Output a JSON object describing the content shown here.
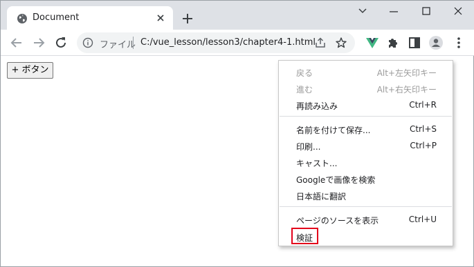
{
  "tab": {
    "title": "Document"
  },
  "omnibox": {
    "scheme_label": "ファイル",
    "url": "C:/vue_lesson/lesson3/chapter4-1.html"
  },
  "page": {
    "button_label": "+ ボタン"
  },
  "context_menu": {
    "items": [
      {
        "label": "戻る",
        "shortcut": "Alt+左矢印キー",
        "enabled": false
      },
      {
        "label": "進む",
        "shortcut": "Alt+右矢印キー",
        "enabled": false
      },
      {
        "label": "再読み込み",
        "shortcut": "Ctrl+R",
        "enabled": true
      },
      {
        "label": "名前を付けて保存...",
        "shortcut": "Ctrl+S",
        "enabled": true
      },
      {
        "label": "印刷...",
        "shortcut": "Ctrl+P",
        "enabled": true
      },
      {
        "label": "キャスト...",
        "shortcut": "",
        "enabled": true
      },
      {
        "label": "Googleで画像を検索",
        "shortcut": "",
        "enabled": true
      },
      {
        "label": "日本語に翻訳",
        "shortcut": "",
        "enabled": true
      },
      {
        "label": "ページのソースを表示",
        "shortcut": "Ctrl+U",
        "enabled": true
      },
      {
        "label": "検証",
        "shortcut": "",
        "enabled": true,
        "highlighted": true
      }
    ]
  },
  "colors": {
    "highlight": "#e3001b",
    "vue_green": "#41b883",
    "tabstrip": "#dee1e6"
  },
  "icons": [
    "globe-icon",
    "close-icon",
    "plus-icon",
    "minimize-icon",
    "maximize-icon",
    "window-close-icon",
    "back-icon",
    "forward-icon",
    "reload-icon",
    "info-icon",
    "share-icon",
    "star-icon",
    "vue-devtools-icon",
    "extensions-icon",
    "side-panel-icon",
    "profile-icon",
    "kebab-menu-icon"
  ]
}
